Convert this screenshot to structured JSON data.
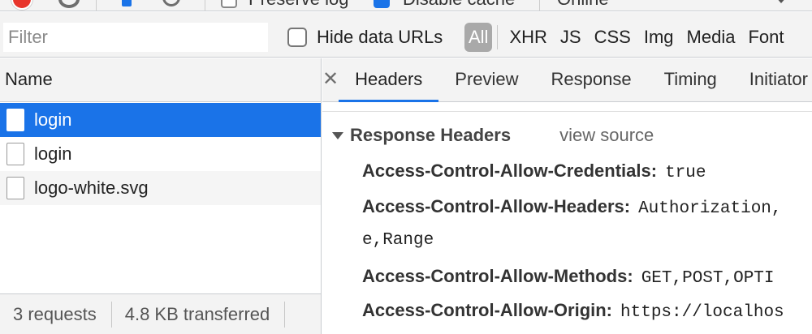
{
  "toolbar": {
    "preserve_log_label": "Preserve log",
    "disable_cache_label": "Disable cache",
    "throttle_value": "Online"
  },
  "filterbar": {
    "filter_placeholder": "Filter",
    "hide_data_urls_label": "Hide data URLs",
    "types": [
      "All",
      "XHR",
      "JS",
      "CSS",
      "Img",
      "Media",
      "Font"
    ],
    "active_type": "All"
  },
  "requests": {
    "column_header": "Name",
    "rows": [
      {
        "name": "login",
        "selected": true
      },
      {
        "name": "login",
        "selected": false
      },
      {
        "name": "logo-white.svg",
        "selected": false
      }
    ],
    "summary": {
      "requests": "3 requests",
      "transferred": "4.8 KB transferred"
    }
  },
  "details": {
    "tabs": [
      "Headers",
      "Preview",
      "Response",
      "Timing",
      "Initiator"
    ],
    "active_tab": "Headers",
    "response_headers": {
      "title": "Response Headers",
      "view_source": "view source",
      "items": [
        {
          "key": "Access-Control-Allow-Credentials:",
          "value": "true"
        },
        {
          "key": "Access-Control-Allow-Headers:",
          "value": "Authorization,",
          "continuation": "e,Range"
        },
        {
          "key": "Access-Control-Allow-Methods:",
          "value": "GET,POST,OPTI"
        },
        {
          "key": "Access-Control-Allow-Origin:",
          "value": "https://localhos"
        }
      ]
    }
  },
  "colors": {
    "accent": "#1a73e8",
    "record": "#e8352b",
    "panel_bg": "#f3f3f3"
  }
}
